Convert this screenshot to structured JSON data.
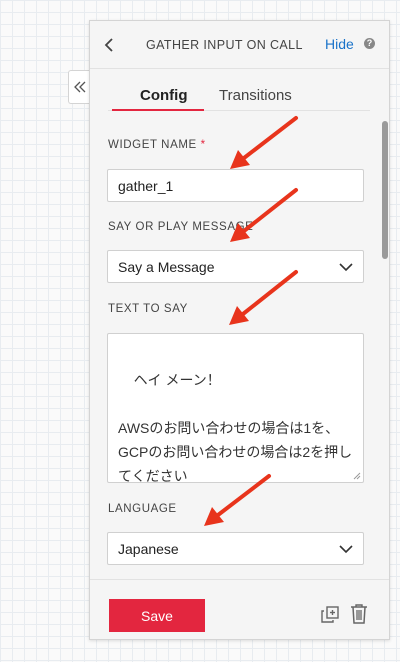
{
  "header": {
    "title": "GATHER INPUT ON CALL",
    "hide_label": "Hide",
    "help_glyph": "?"
  },
  "tabs": [
    {
      "label": "Config",
      "active": true
    },
    {
      "label": "Transitions",
      "active": false
    }
  ],
  "form": {
    "widget_name": {
      "label": "WIDGET NAME",
      "required_mark": "*",
      "value": "gather_1"
    },
    "say_or_play": {
      "label": "SAY OR PLAY MESSAGE",
      "value": "Say a Message"
    },
    "text_to_say": {
      "label": "TEXT TO SAY",
      "value": "ヘイ メーン！\n\nAWSのお問い合わせの場合は1を、GCPのお問い合わせの場合は2を押してください"
    },
    "language": {
      "label": "LANGUAGE",
      "value": "Japanese"
    }
  },
  "footer": {
    "save_label": "Save"
  },
  "icons": {
    "collapse": "double-chevron-left-icon",
    "back": "chevron-left-icon",
    "help": "question-circle-icon",
    "dropdown": "chevron-down-icon",
    "duplicate": "duplicate-icon",
    "delete": "trash-icon"
  },
  "colors": {
    "accent": "#e3263f",
    "link": "#1a73c9",
    "annotation_arrow": "#e8341c"
  }
}
